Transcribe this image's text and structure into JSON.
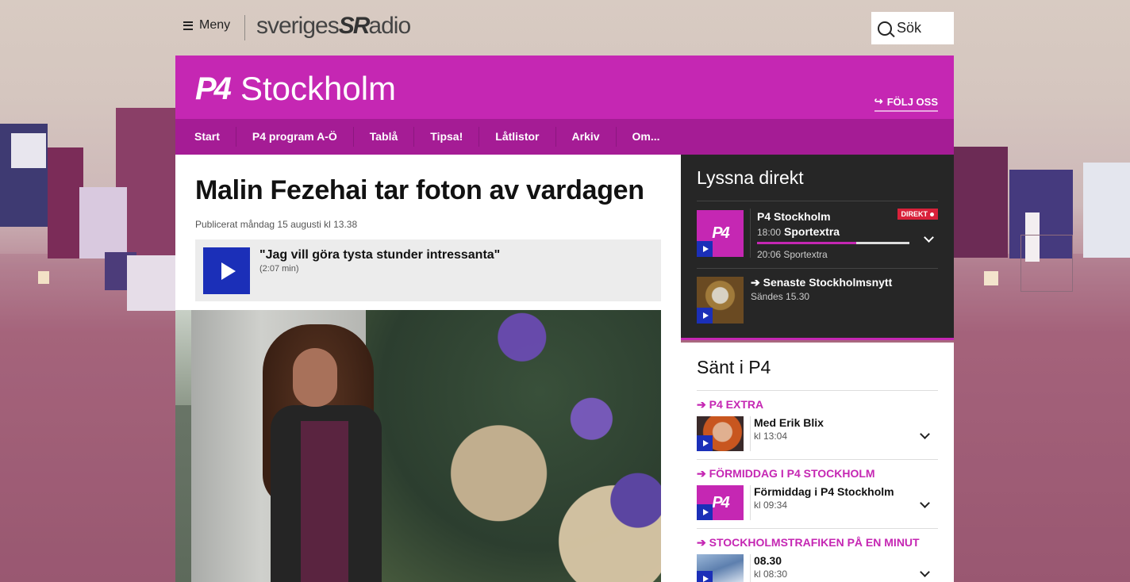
{
  "topbar": {
    "menu_label": "Meny",
    "logo_text_a": "sveriges",
    "logo_text_b": "SR",
    "logo_text_c": "adio",
    "search_label": "Sök"
  },
  "header": {
    "channel_badge": "P4",
    "channel_name": "Stockholm",
    "follow_label": "FÖLJ OSS",
    "nav": [
      "Start",
      "P4 program A-Ö",
      "Tablå",
      "Tipsa!",
      "Låtlistor",
      "Arkiv",
      "Om..."
    ]
  },
  "article": {
    "title": "Malin Fezehai tar foton av vardagen",
    "published": "Publicerat måndag 15 augusti kl 13.38",
    "audio_title": "\"Jag vill göra tysta stunder intressanta\"",
    "audio_duration": "(2:07 min)"
  },
  "live": {
    "heading": "Lyssna direkt",
    "station": "P4 Stockholm",
    "badge": "DIREKT",
    "now_time": "18:00",
    "now_program": "Sportextra",
    "progress": 0.65,
    "next": "20:06 Sportextra",
    "thumb_label": "P4",
    "news_title": "Senaste Stockholmsnytt",
    "news_sub": "Sändes 15.30"
  },
  "sent": {
    "heading": "Sänt i P4",
    "items": [
      {
        "category": "P4 EXTRA",
        "title": "Med Erik Blix",
        "time": "kl 13:04"
      },
      {
        "category": "FÖRMIDDAG I P4 STOCKHOLM",
        "title": "Förmiddag i P4 Stockholm",
        "time": "kl 09:34",
        "thumb_label": "P4"
      },
      {
        "category": "STOCKHOLMSTRAFIKEN PÅ EN MINUT",
        "title": "08.30",
        "time": "kl 08:30"
      }
    ]
  },
  "colors": {
    "brand": "#c527b3",
    "brand_dark": "#a51c95",
    "play": "#1b2fb8",
    "live_bg": "#262626",
    "direkt_red": "#d9213a"
  }
}
